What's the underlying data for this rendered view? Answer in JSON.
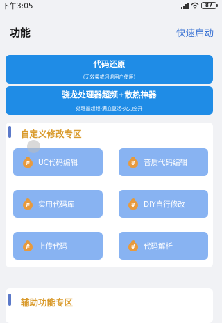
{
  "status_bar": {
    "time": "下午3:05",
    "battery": "87"
  },
  "header": {
    "title": "功能",
    "action": "快速启动"
  },
  "banners": [
    {
      "title": "代码还原",
      "subtitle": "(无效果或闪退用户使用)"
    },
    {
      "title": "骁龙处理器超频+散热神器",
      "subtitle": "处理器超频-满血复活-火力全开"
    }
  ],
  "sections": [
    {
      "title": "自定义修改专区",
      "items": [
        {
          "label": "UC代码编辑"
        },
        {
          "label": "音质代码编辑"
        },
        {
          "label": "实用代码库"
        },
        {
          "label": "DIY自行修改"
        },
        {
          "label": "上传代码"
        },
        {
          "label": "代码解析"
        }
      ]
    },
    {
      "title": "辅助功能专区"
    }
  ],
  "colors": {
    "banner": "#1f8ce6",
    "button": "#88b3f2",
    "section_title": "#d99a2b",
    "accent": "#3c74d4"
  },
  "icons": {
    "feature_icon": "money-bag-icon"
  }
}
